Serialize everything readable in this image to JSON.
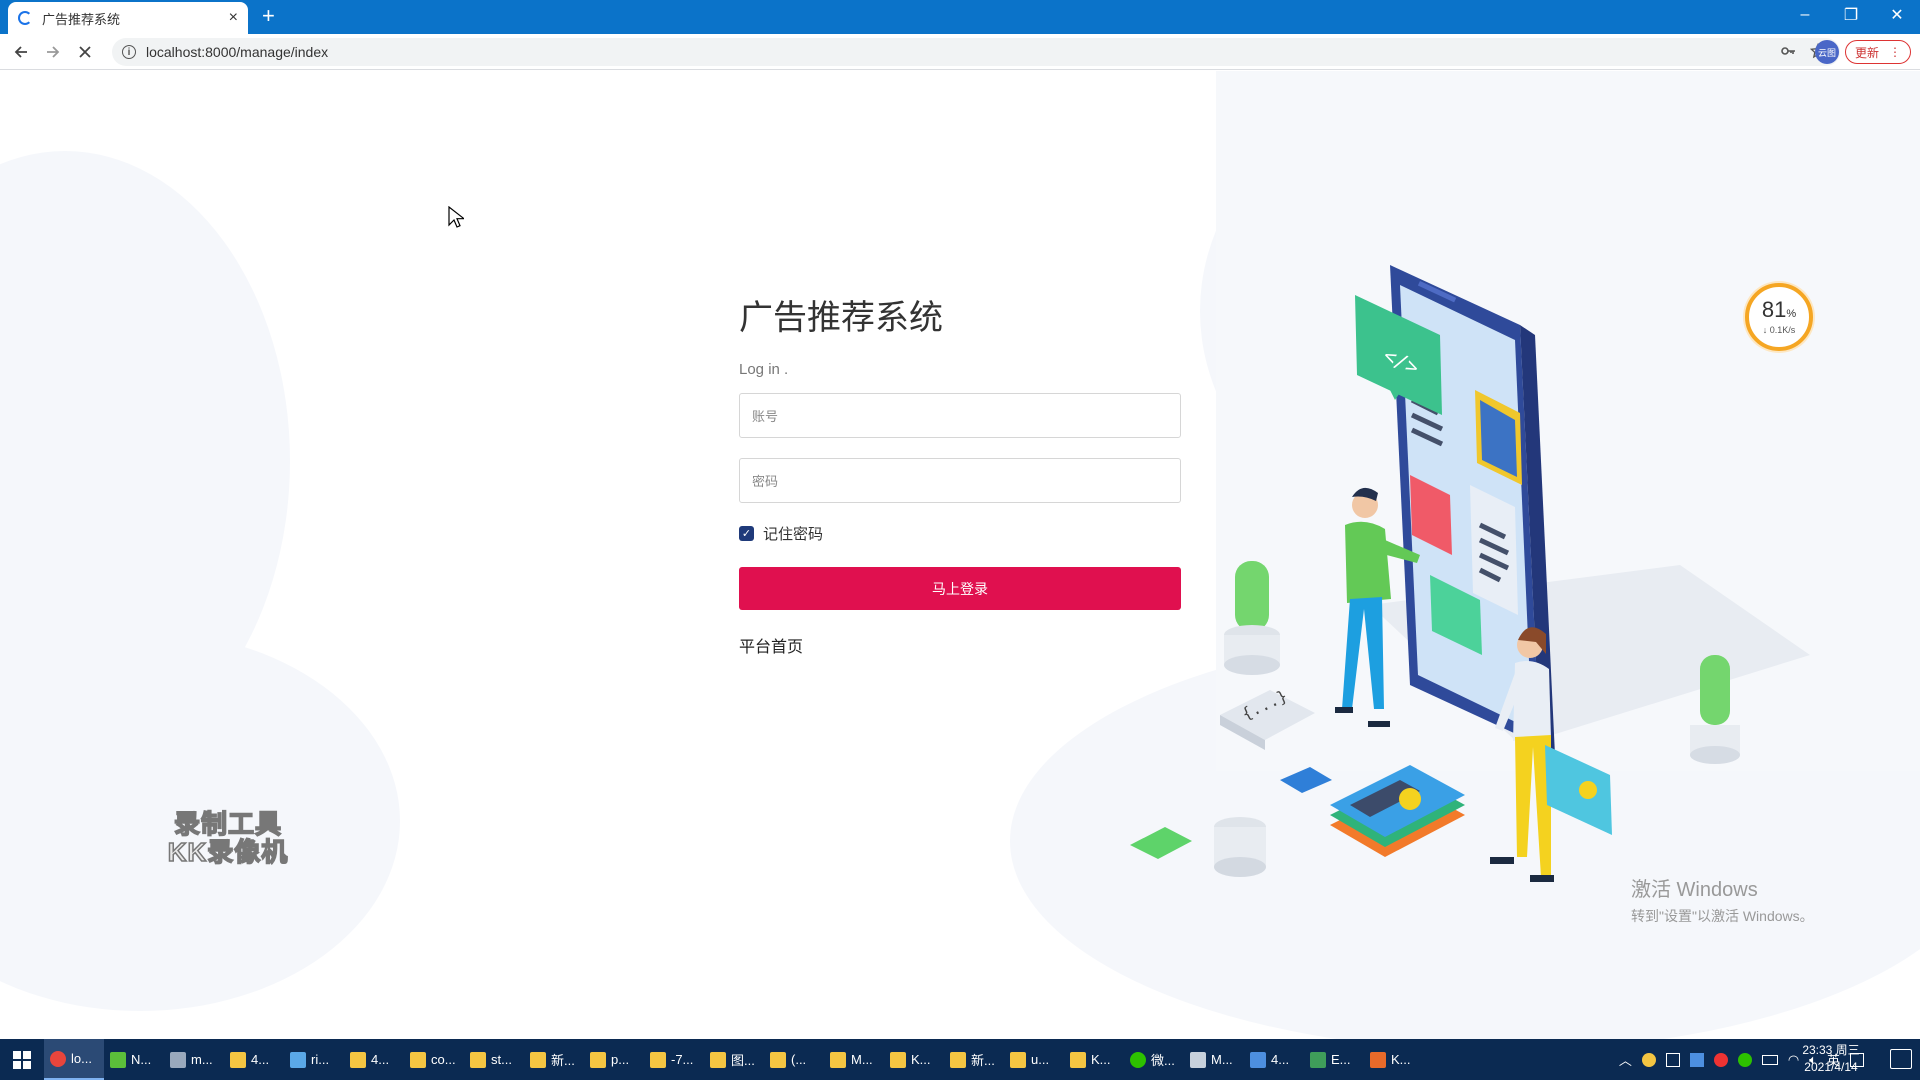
{
  "browser": {
    "tab_title": "广告推荐系统",
    "tab_close": "×",
    "new_tab": "+",
    "url": "localhost:8000/manage/index",
    "profile_label": "云图",
    "update_label": "更新",
    "menu_dots": "⋮",
    "window_controls": {
      "minimize": "–",
      "restore": "❐",
      "close": "✕"
    }
  },
  "login": {
    "title": "广告推荐系统",
    "subtitle": "Log in .",
    "account_placeholder": "账号",
    "password_placeholder": "密码",
    "remember_label": "记住密码",
    "remember_checked": true,
    "submit_label": "马上登录",
    "home_link": "平台首页",
    "accent_color": "#e0104f"
  },
  "widget": {
    "percent": "81",
    "percent_unit": "%",
    "rate": "↓ 0.1K/s"
  },
  "overlay": {
    "watermark_line1": "录制工具",
    "watermark_line2": "KK录像机",
    "activate_line1": "激活 Windows",
    "activate_line2": "转到\"设置\"以激活 Windows。"
  },
  "taskbar": {
    "items": [
      {
        "label": "lo...",
        "icon": "chrome-icon",
        "color": "#e8453c"
      },
      {
        "label": "N...",
        "icon": "app-icon",
        "color": "#5bbf3a"
      },
      {
        "label": "m...",
        "icon": "app-icon",
        "color": "#9aa9bd"
      },
      {
        "label": "4...",
        "icon": "folder-icon",
        "color": "#f4c542"
      },
      {
        "label": "ri...",
        "icon": "app-icon",
        "color": "#5aa8e8"
      },
      {
        "label": "4...",
        "icon": "folder-icon",
        "color": "#f4c542"
      },
      {
        "label": "co...",
        "icon": "folder-icon",
        "color": "#f4c542"
      },
      {
        "label": "st...",
        "icon": "folder-icon",
        "color": "#f4c542"
      },
      {
        "label": "新...",
        "icon": "folder-icon",
        "color": "#f4c542"
      },
      {
        "label": "p...",
        "icon": "folder-icon",
        "color": "#f4c542"
      },
      {
        "label": "-7...",
        "icon": "folder-icon",
        "color": "#f4c542"
      },
      {
        "label": "图...",
        "icon": "folder-icon",
        "color": "#f4c542"
      },
      {
        "label": "(...",
        "icon": "folder-icon",
        "color": "#f4c542"
      },
      {
        "label": "M...",
        "icon": "folder-icon",
        "color": "#f4c542"
      },
      {
        "label": "K...",
        "icon": "folder-icon",
        "color": "#f4c542"
      },
      {
        "label": "新...",
        "icon": "folder-icon",
        "color": "#f4c542"
      },
      {
        "label": "u...",
        "icon": "folder-icon",
        "color": "#f4c542"
      },
      {
        "label": "K...",
        "icon": "folder-icon",
        "color": "#f4c542"
      },
      {
        "label": "微...",
        "icon": "wechat-icon",
        "color": "#2dc100"
      },
      {
        "label": "M...",
        "icon": "app-icon",
        "color": "#c7d0dc"
      },
      {
        "label": "4...",
        "icon": "vs-icon",
        "color": "#4d8fe0"
      },
      {
        "label": "E...",
        "icon": "excel-icon",
        "color": "#3f9d5a"
      },
      {
        "label": "K...",
        "icon": "app-icon",
        "color": "#e86a2a"
      }
    ],
    "tray_lang": "英",
    "time": "23:33 周三",
    "date": "2021/4/14"
  }
}
